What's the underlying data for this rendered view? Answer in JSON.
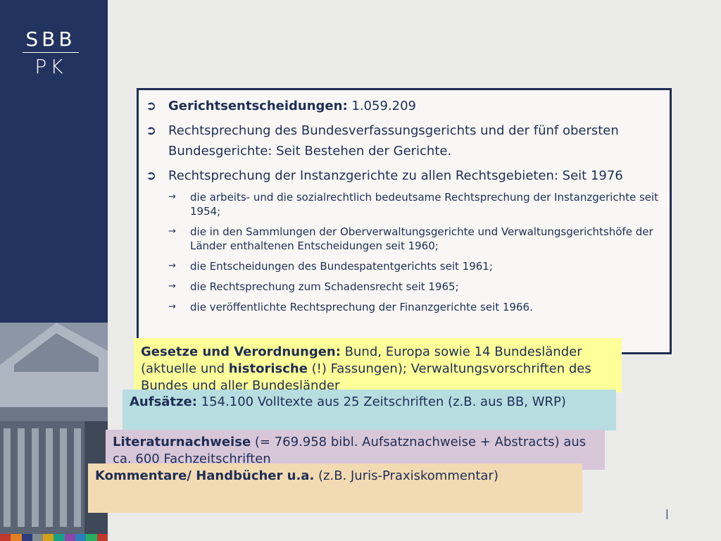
{
  "logo": {
    "line1": "SBB",
    "line2": "PK"
  },
  "main_box": {
    "bullets": [
      {
        "bold": "Gerichtsentscheidungen:",
        "text": " 1.059.209"
      },
      {
        "bold": "",
        "text": "Rechtsprechung des Bundesverfassungsgerichts und der fünf obersten Bundesgerichte: Seit Bestehen der Gerichte."
      },
      {
        "bold": "",
        "text": "Rechtsprechung der Instanzgerichte zu allen Rechtsgebieten: Seit 1976"
      }
    ],
    "sub_bullets": [
      "die arbeits- und die sozialrechtlich bedeutsame Rechtsprechung der Instanzgerichte seit 1954;",
      "die in den Sammlungen der Oberverwaltungsgerichte und Verwaltungsgerichtshöfe der Länder enthaltenen Entscheidungen seit 1960;",
      "die Entscheidungen des Bundespatentgerichts seit 1961;",
      "die Rechtsprechung zum Schadensrecht seit 1965;",
      "die veröffentlichte Rechtsprechung der Finanzgerichte seit 1966."
    ]
  },
  "notes": {
    "gesetze": {
      "bold": "Gesetze und Verordnungen:",
      "text1": " Bund, Europa sowie 14 Bundesländer (aktuelle und ",
      "bold2": "historische",
      "text2": " (!) Fassungen); Verwaltungsvorschriften des Bundes und aller Bundesländer"
    },
    "aufsaetze": {
      "bold": "Aufsätze:",
      "text": " 154.100 Volltexte aus 25 Zeitschriften (z.B. aus BB, WRP)"
    },
    "literatur": {
      "bold": "Literaturnachweise",
      "text": " (= 769.958 bibl. Aufsatznachweise + Abstracts) aus ca. 600 Fachzeitschriften"
    },
    "kommentare": {
      "bold": "Kommentare/ Handbücher u.a.",
      "text": " (z.B. Juris-Praxiskommentar)"
    }
  },
  "page_mark": "|",
  "colors": {
    "sidebar": "#23335f",
    "text": "#1f2e55",
    "note_yellow": "#ffff99",
    "note_blue": "#b7dde0",
    "note_purple": "#d8c7d8",
    "note_orange": "#f2dab2"
  }
}
